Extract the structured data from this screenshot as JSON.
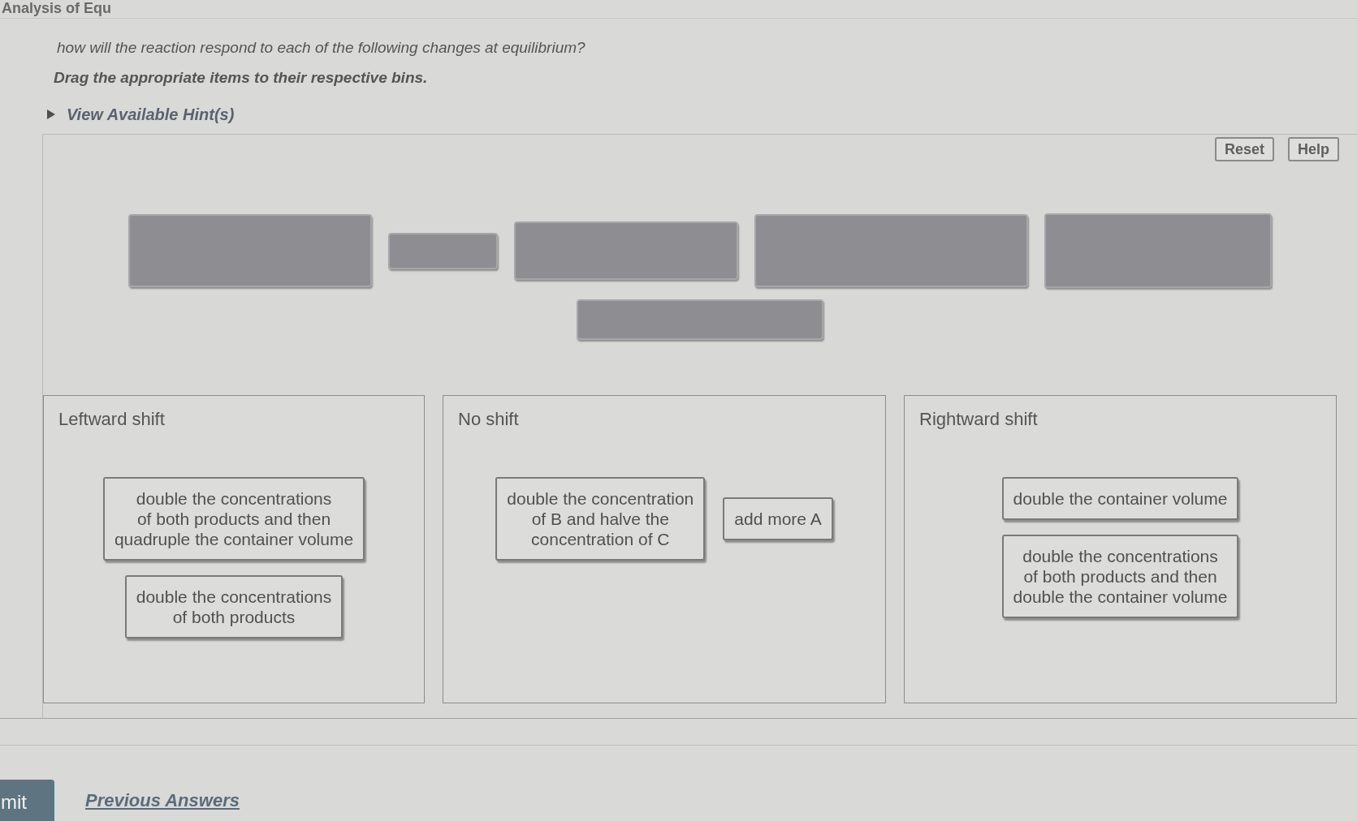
{
  "page_title": "Analysis of Equ",
  "question": "how will the reaction respond to each of the following changes at equilibrium?",
  "instruction": "Drag the appropriate items to their respective bins.",
  "hint_toggle": {
    "label": "View Available Hint(s)",
    "expanded": false
  },
  "panel_buttons": [
    "Reset",
    "Help"
  ],
  "bins": [
    {
      "label": "Leftward shift",
      "items": [
        "double the concentrations\nof both products and then\nquadruple the container volume",
        "double the concentrations\nof both products"
      ]
    },
    {
      "label": "No shift",
      "items": [
        "double the concentration\nof B and halve the\nconcentration of C",
        "add more A"
      ]
    },
    {
      "label": "Rightward shift",
      "items": [
        "double the container volume",
        "double the concentrations\nof both products and then\ndouble the container volume"
      ]
    }
  ],
  "submit_button": "mit",
  "previous_answers_link": "Previous Answers"
}
